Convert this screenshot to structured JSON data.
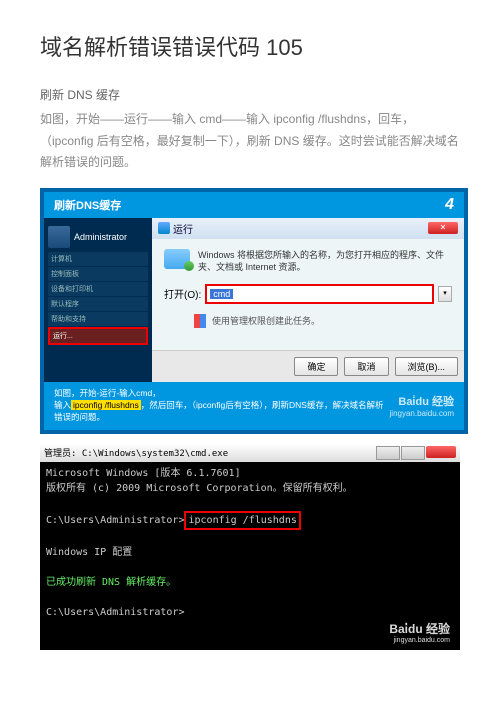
{
  "title": "域名解析错误错误代码 105",
  "subtitle": "刷新 DNS 缓存",
  "description": "如图，开始——运行——输入 cmd——输入 ipconfig /flushdns，回车，（ipconfig 后有空格，最好复制一下），刷新 DNS 缓存。这时尝试能否解决域名解析错误的问题。",
  "slide": {
    "header": "刷新DNS缓存",
    "stepNum": "4",
    "startMenu": {
      "user": "Administrator",
      "items": [
        "计算机",
        "控制面板",
        "设备和打印机",
        "默认程序",
        "帮助和支持"
      ],
      "search": "运行..."
    },
    "runDialog": {
      "title": "运行",
      "message": "Windows 将根据您所输入的名称，为您打开相应的程序、文件夹、文档或 Internet 资源。",
      "openLabel": "打开(O):",
      "inputValue": "cmd",
      "adminLabel": "使用管理权限创建此任务。",
      "btnOk": "确定",
      "btnCancel": "取消",
      "btnBrowse": "浏览(B)..."
    },
    "footer": {
      "line1": "如图，开始-运行-输入cmd，",
      "prefix": "输入",
      "command": "ipconfig /flushdns",
      "suffix": "，然后回车，（ipconfig后有空格），刷新DNS缓存，解决域名解析错误的问题。"
    },
    "watermark": {
      "logo": "Bai̇du 经验",
      "url": "jingyan.baidu.com"
    }
  },
  "cmd": {
    "title": "管理员: C:\\Windows\\system32\\cmd.exe",
    "line1": "Microsoft Windows [版本 6.1.7601]",
    "line2": "版权所有 (c) 2009 Microsoft Corporation。保留所有权利。",
    "prompt1": "C:\\Users\\Administrator>",
    "command": "ipconfig /flushdns",
    "cfgHeader": "Windows IP 配置",
    "success": "已成功刷新 DNS 解析缓存。",
    "prompt2": "C:\\Users\\Administrator>",
    "watermark": {
      "logo": "Bai̇du 经验",
      "url": "jingyan.baidu.com"
    }
  }
}
